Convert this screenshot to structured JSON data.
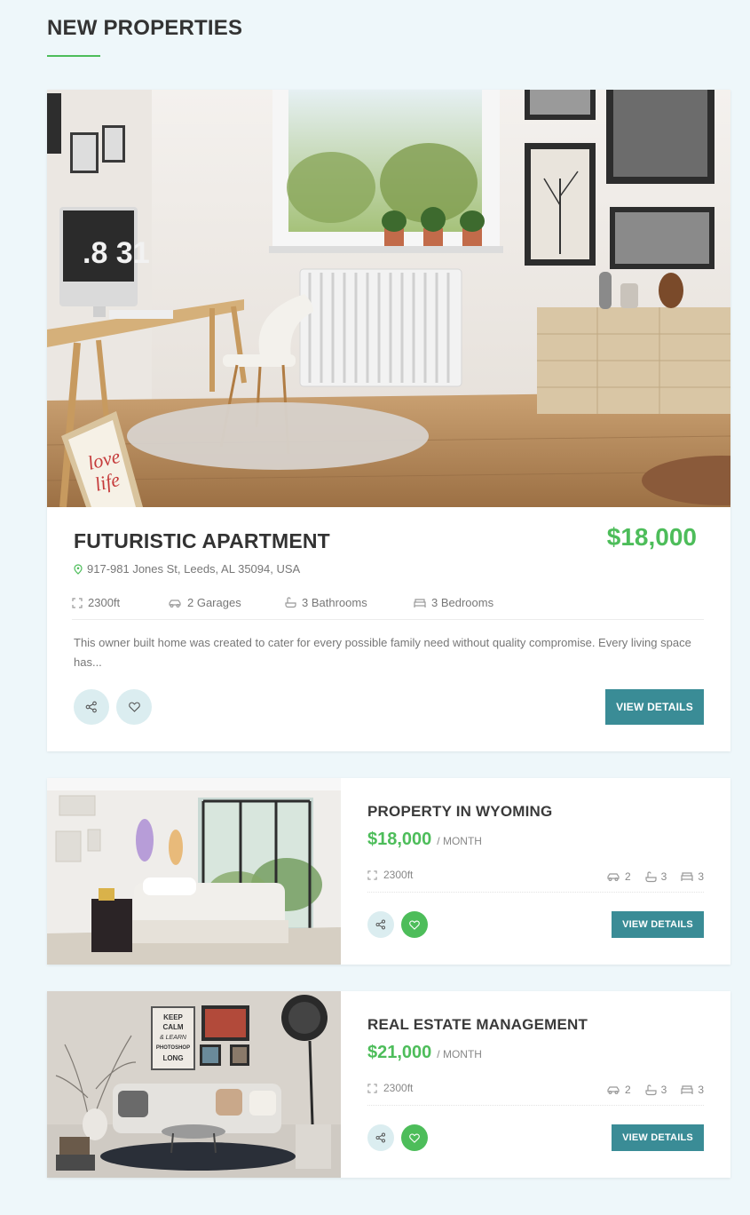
{
  "section": {
    "title": "NEW PROPERTIES"
  },
  "colors": {
    "accent_green": "#4dbd5a",
    "button_teal": "#3a8c96",
    "page_bg": "#eef7fa"
  },
  "featured": {
    "title": "FUTURISTIC APARTMENT",
    "price": "$18,000",
    "address": "917-981 Jones St, Leeds, AL 35094, USA",
    "features": {
      "area": "2300ft",
      "garages": "2 Garages",
      "bathrooms": "3 Bathrooms",
      "bedrooms": "3 Bedrooms"
    },
    "description": "This owner built home was created to cater for every possible family need without quality compromise. Every living space has...",
    "button": "VIEW DETAILS",
    "image": {
      "desk_clock": ".8 31",
      "poster": "love life"
    }
  },
  "listings": [
    {
      "title": "PROPERTY IN WYOMING",
      "price": "$18,000",
      "period": "/ MONTH",
      "area": "2300ft",
      "garages": "2",
      "bathrooms": "3",
      "bedrooms": "3",
      "favorited": true,
      "button": "VIEW DETAILS"
    },
    {
      "title": "REAL ESTATE MANAGEMENT",
      "price": "$21,000",
      "period": "/ MONTH",
      "area": "2300ft",
      "garages": "2",
      "bathrooms": "3",
      "bedrooms": "3",
      "favorited": true,
      "button": "VIEW DETAILS",
      "image": {
        "poster_lines": [
          "KEEP",
          "CALM",
          "& LEARN",
          "PHOTOSHOP",
          "LONG"
        ]
      }
    }
  ],
  "icons": {
    "area": "expand-corners-icon",
    "garage": "car-icon",
    "bathroom": "bathtub-icon",
    "bedroom": "bed-icon",
    "address": "map-pin-icon",
    "share": "share-icon",
    "favorite": "heart-icon"
  }
}
